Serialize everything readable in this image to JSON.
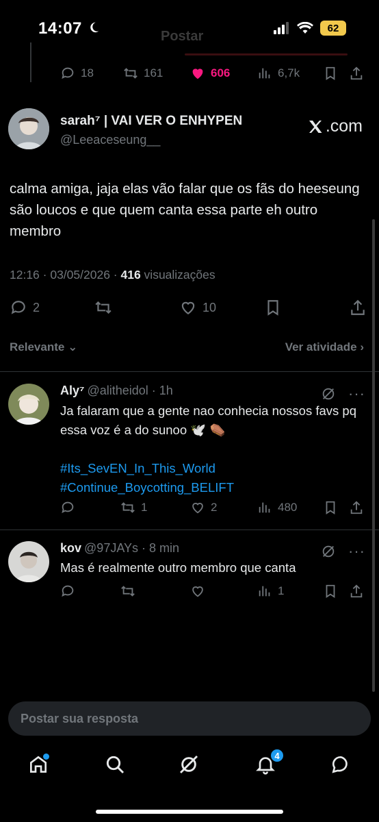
{
  "status_bar": {
    "time": "14:07",
    "battery": "62"
  },
  "ghost_header": {
    "title": "Postar"
  },
  "prev_post_actions": {
    "replies": "18",
    "reposts": "161",
    "likes": "606",
    "views": "6,7k",
    "like_color": "#f91880"
  },
  "main_post": {
    "display_name": "sarah⁷ | VAI VER O ENHYPEN",
    "handle": "@Leeaceseung__",
    "watermark": ".com",
    "text": "calma amiga, jaja elas vão falar que os fãs do heeseung são loucos e que quem canta essa parte eh outro membro",
    "time_date": "12:16 · 03/05/2026 · ",
    "views_count": "416",
    "views_label": " visualizações",
    "replies": "2",
    "reposts": "",
    "likes": "10"
  },
  "filter": {
    "sort_label": "Relevante",
    "activity_label": "Ver atividade"
  },
  "replies": [
    {
      "display_name": "Aly⁷",
      "handle_time": "@alitheidol · 1h",
      "text": "Ja falaram que a gente nao conhecia nossos favs pq essa voz é a do sunoo 🕊️ ⚰️",
      "hashtags": [
        "#Its_SevEN_In_This_World",
        "#Continue_Boycotting_BELIFT"
      ],
      "replies": "",
      "reposts": "1",
      "likes": "2",
      "views": "480"
    },
    {
      "display_name": "kov",
      "handle_time": "@97JAYs · 8 min",
      "text": "Mas é realmente outro membro que canta",
      "replies": "",
      "reposts": "",
      "likes": "",
      "views": "1"
    }
  ],
  "compose": {
    "placeholder": "Postar sua resposta"
  },
  "tabbar": {
    "notifications_badge": "4"
  },
  "colors": {
    "accent": "#1d9bf0",
    "muted": "#71767b",
    "text": "#e7e9ea",
    "background": "#000000",
    "battery": "#f2c94c"
  }
}
